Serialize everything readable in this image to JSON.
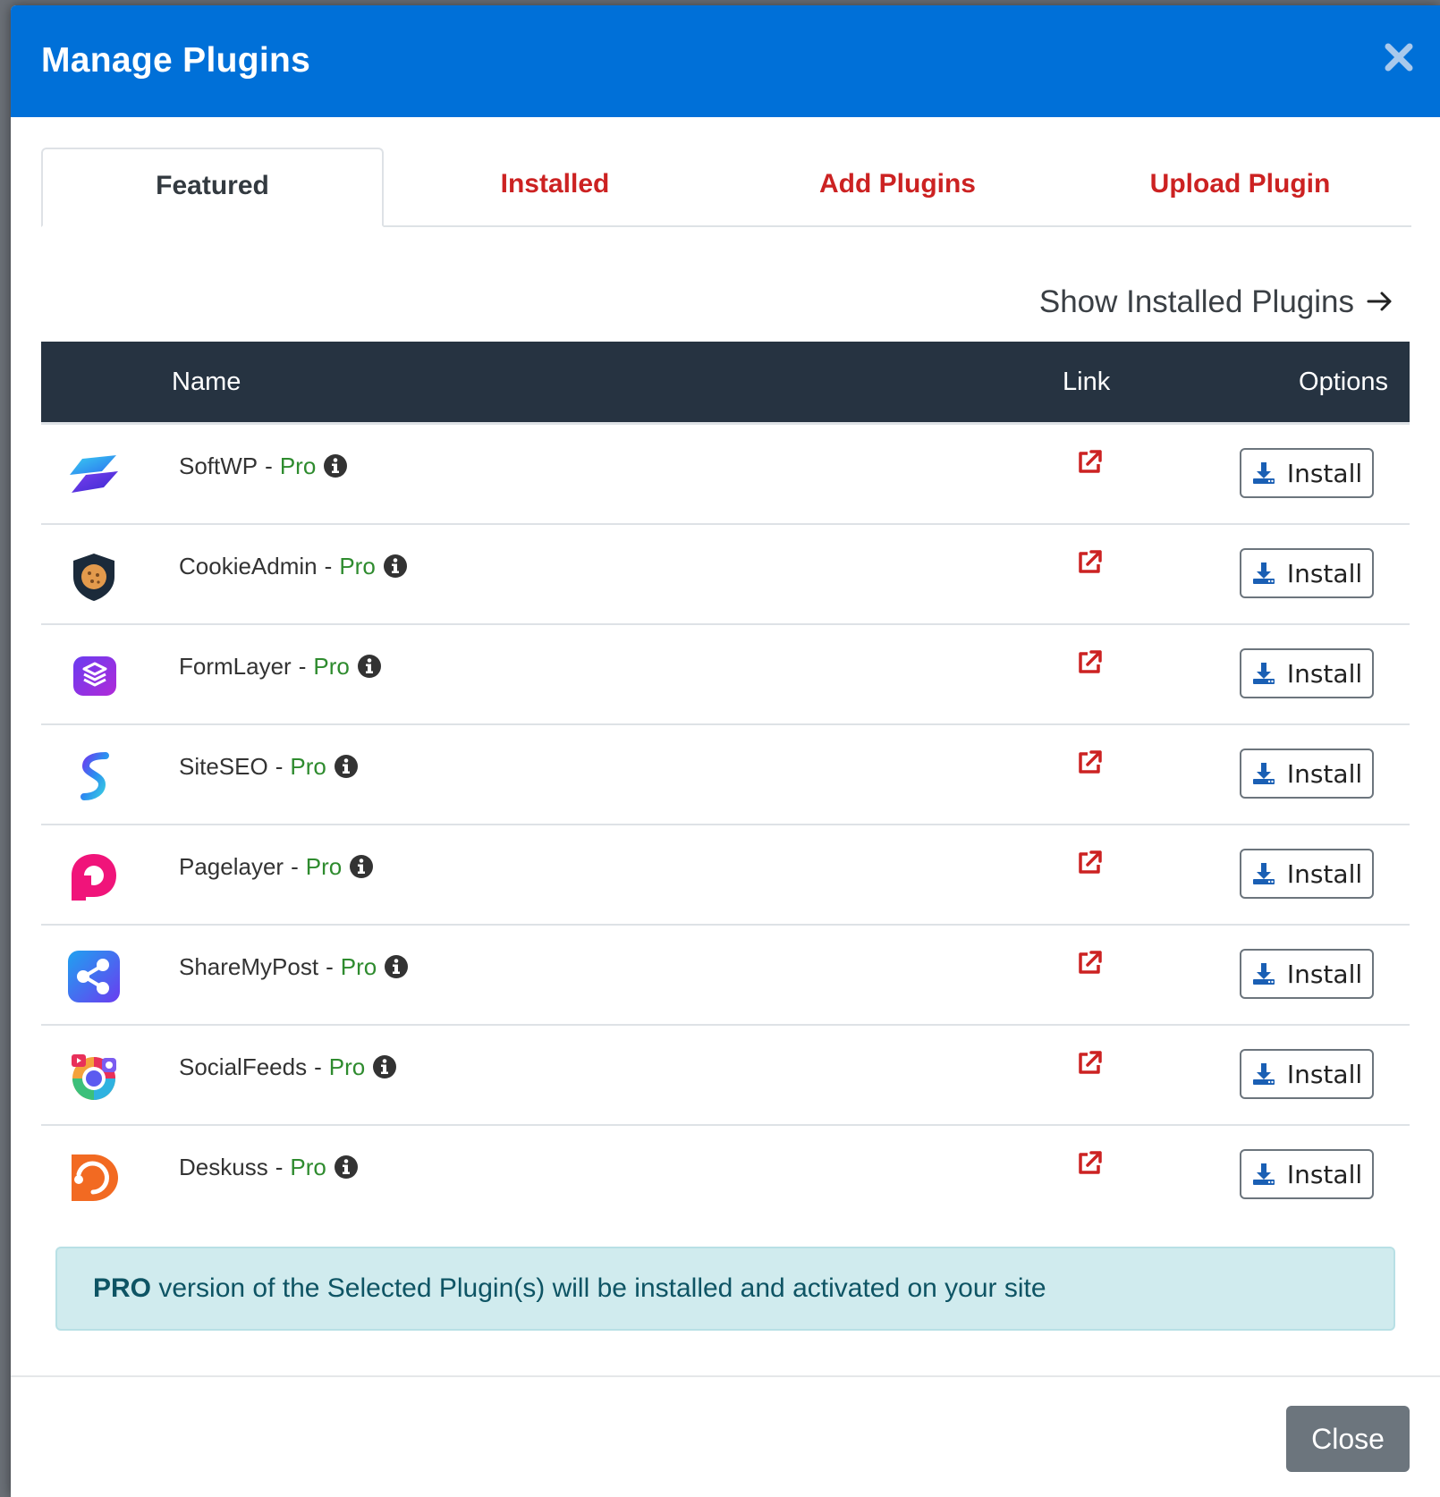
{
  "modal": {
    "title": "Manage Plugins",
    "header_color": "#0070d8"
  },
  "tabs": [
    {
      "label": "Featured",
      "active": true
    },
    {
      "label": "Installed",
      "active": false
    },
    {
      "label": "Add Plugins",
      "active": false
    },
    {
      "label": "Upload Plugin",
      "active": false
    }
  ],
  "show_installed_label": "Show Installed Plugins",
  "table": {
    "headers": {
      "name": "Name",
      "link": "Link",
      "options": "Options"
    },
    "rows": [
      {
        "name": "SoftWP",
        "sep": "-",
        "tier": "Pro",
        "action": "Install",
        "icon": "softwp-logo-icon"
      },
      {
        "name": "CookieAdmin",
        "sep": "-",
        "tier": "Pro",
        "action": "Install",
        "icon": "cookieadmin-logo-icon"
      },
      {
        "name": "FormLayer",
        "sep": "-",
        "tier": "Pro",
        "action": "Install",
        "icon": "formlayer-logo-icon"
      },
      {
        "name": "SiteSEO",
        "sep": "-",
        "tier": "Pro",
        "action": "Install",
        "icon": "siteseo-logo-icon"
      },
      {
        "name": "Pagelayer",
        "sep": "-",
        "tier": "Pro",
        "action": "Install",
        "icon": "pagelayer-logo-icon"
      },
      {
        "name": "ShareMyPost",
        "sep": "-",
        "tier": "Pro",
        "action": "Install",
        "icon": "sharemypost-logo-icon"
      },
      {
        "name": "SocialFeeds",
        "sep": "-",
        "tier": "Pro",
        "action": "Install",
        "icon": "socialfeeds-logo-icon"
      },
      {
        "name": "Deskuss",
        "sep": "-",
        "tier": "Pro",
        "action": "Install",
        "icon": "deskuss-logo-icon"
      }
    ]
  },
  "alert": {
    "strong": "PRO",
    "text": " version of the Selected Plugin(s) will be installed and activated on your site"
  },
  "footer": {
    "close_label": "Close"
  },
  "colors": {
    "link_red": "#cc2222",
    "pro_green": "#2e8b2e",
    "table_header": "#263341",
    "alert_bg": "#d0ebee"
  }
}
